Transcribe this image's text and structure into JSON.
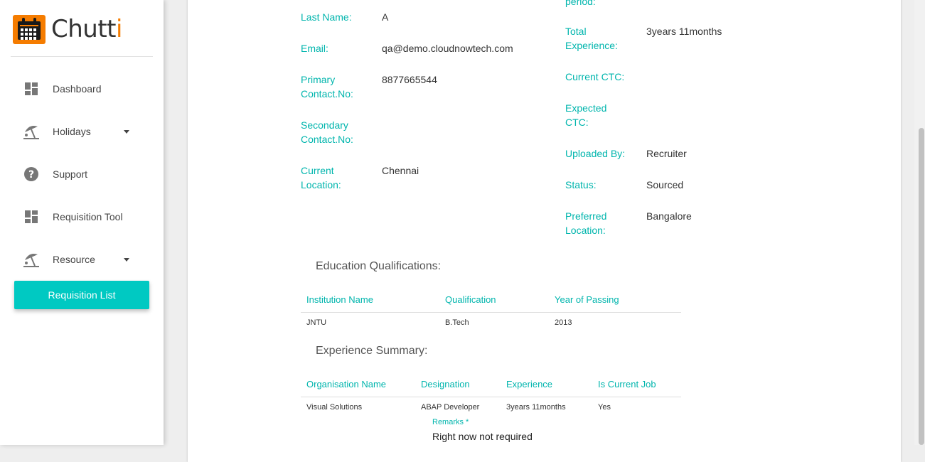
{
  "app": {
    "logo_text_main": "Chutt",
    "logo_text_accent": "i"
  },
  "sidebar": {
    "items": [
      {
        "label": "Dashboard",
        "icon": "dashboard-icon"
      },
      {
        "label": "Holidays",
        "icon": "beach-icon",
        "has_caret": true
      },
      {
        "label": "Support",
        "icon": "help-icon"
      },
      {
        "label": "Requisition Tool",
        "icon": "dashboard-icon"
      },
      {
        "label": "Resource",
        "icon": "beach-icon",
        "has_caret": true
      }
    ],
    "active": {
      "label": "Requisition List"
    }
  },
  "profile": {
    "left": [
      {
        "label": "Last Name:",
        "value": "A"
      },
      {
        "label": "Email:",
        "value": "qa@demo.cloudnowtech.com"
      },
      {
        "label": "Primary Contact.No:",
        "value": "8877665544"
      },
      {
        "label": "Secondary Contact.No:",
        "value": ""
      },
      {
        "label": "Current Location:",
        "value": "Chennai"
      }
    ],
    "right": [
      {
        "label": "period:",
        "value": ""
      },
      {
        "label": "Total Experience:",
        "value": "3years 11months"
      },
      {
        "label": "Current CTC:",
        "value": ""
      },
      {
        "label": "Expected CTC:",
        "value": ""
      },
      {
        "label": "Uploaded By:",
        "value": "Recruiter"
      },
      {
        "label": "Status:",
        "value": "Sourced"
      },
      {
        "label": "Preferred Location:",
        "value": "Bangalore"
      }
    ]
  },
  "education": {
    "title": "Education Qualifications:",
    "columns": [
      "Institution Name",
      "Qualification",
      "Year of Passing"
    ],
    "rows": [
      [
        "JNTU",
        "B.Tech",
        "2013"
      ]
    ]
  },
  "experience": {
    "title": "Experience Summary:",
    "columns": [
      "Organisation Name",
      "Designation",
      "Experience",
      "Is Current Job"
    ],
    "rows": [
      [
        "Visual Solutions",
        "ABAP Developer",
        "3years 11months",
        "Yes"
      ]
    ]
  },
  "remarks": {
    "label": "Remarks *",
    "value": "Right now not required"
  },
  "colors": {
    "accent": "#00c9c2",
    "label": "#00b5ad",
    "brand": "#f57c00"
  }
}
